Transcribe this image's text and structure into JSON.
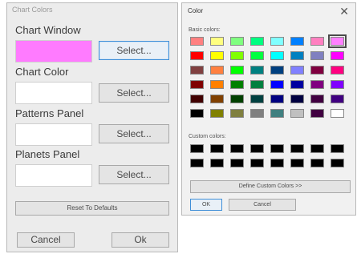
{
  "chart_colors_window": {
    "title": "Chart Colors",
    "sections": [
      {
        "label": "Chart Window",
        "button": "Select...",
        "swatch_color": "#ff7bff"
      },
      {
        "label": "Chart Color",
        "button": "Select...",
        "swatch_color": "#ffffff"
      },
      {
        "label": "Patterns Panel",
        "button": "Select...",
        "swatch_color": "#ffffff"
      },
      {
        "label": "Planets Panel",
        "button": "Select...",
        "swatch_color": "#ffffff"
      }
    ],
    "reset_label": "Reset To Defaults",
    "cancel_label": "Cancel",
    "ok_label": "Ok"
  },
  "color_dialog": {
    "title": "Color",
    "close_icon": "close-icon",
    "basic_label": "Basic colors:",
    "custom_label": "Custom colors:",
    "basic_colors": [
      [
        "#ff8080",
        "#ffff80",
        "#80ff80",
        "#00ff80",
        "#80ffff",
        "#0080ff",
        "#ff80c0",
        "#ff80ff"
      ],
      [
        "#ff0000",
        "#ffff00",
        "#80ff00",
        "#00ff40",
        "#00ffff",
        "#0080c0",
        "#8080c0",
        "#ff00ff"
      ],
      [
        "#804040",
        "#ff8040",
        "#00ff00",
        "#008080",
        "#004080",
        "#8080ff",
        "#800040",
        "#ff0080"
      ],
      [
        "#800000",
        "#ff8000",
        "#008000",
        "#008040",
        "#0000ff",
        "#0000a0",
        "#800080",
        "#8000ff"
      ],
      [
        "#400000",
        "#804000",
        "#004000",
        "#004040",
        "#000080",
        "#000040",
        "#400040",
        "#400080"
      ],
      [
        "#000000",
        "#808000",
        "#808040",
        "#808080",
        "#408080",
        "#c0c0c0",
        "#400040",
        "#ffffff"
      ]
    ],
    "selected_basic": "#ff80ff",
    "custom_colors": [
      [
        "#000000",
        "#000000",
        "#000000",
        "#000000",
        "#000000",
        "#000000",
        "#000000",
        "#000000"
      ],
      [
        "#000000",
        "#000000",
        "#000000",
        "#000000",
        "#000000",
        "#000000",
        "#000000",
        "#000000"
      ]
    ],
    "define_label": "Define Custom Colors >>",
    "ok_label": "OK",
    "cancel_label": "Cancel"
  }
}
